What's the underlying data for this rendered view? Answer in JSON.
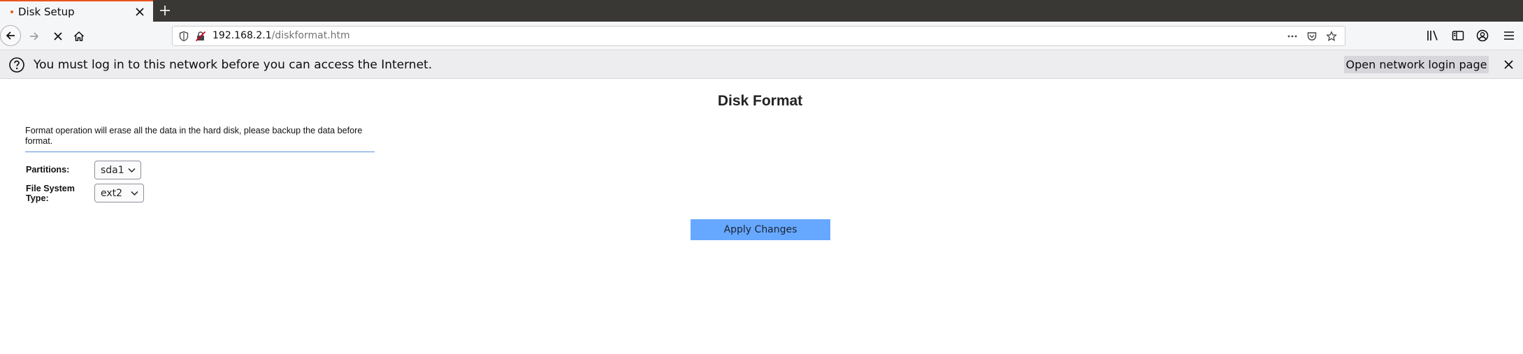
{
  "browser": {
    "tab_title": "Disk Setup",
    "url_host": "192.168.2.1",
    "url_path": "/diskformat.htm"
  },
  "notification": {
    "message": "You must log in to this network before you can access the Internet.",
    "button_label": "Open network login page"
  },
  "page": {
    "title": "Disk Format",
    "intro": "Format operation will erase all the data in the hard disk, please backup the data before format.",
    "partitions_label": "Partitions:",
    "partitions_value": "sda1",
    "fs_type_label_line1": "File System",
    "fs_type_label_line2": "Type:",
    "fs_type_value": "ext2",
    "apply_label": "Apply Changes"
  },
  "icons": {
    "tab_close": "close-icon",
    "new_tab": "plus-icon",
    "back": "back-arrow-icon",
    "forward": "forward-arrow-icon",
    "stop": "stop-icon",
    "home": "home-icon",
    "site_info": "shield-icon",
    "insecure": "insecure-lock-icon",
    "page_actions": "more-icon",
    "pocket": "pocket-icon",
    "bookmark": "star-icon",
    "library": "library-icon",
    "sidebar": "sidebar-icon",
    "account": "account-icon",
    "menu": "hamburger-menu-icon",
    "help": "question-icon",
    "dismiss": "close-icon"
  },
  "colors": {
    "accent": "#e95420",
    "apply_button": "#66a8ff",
    "divider": "#5b8fd8"
  }
}
